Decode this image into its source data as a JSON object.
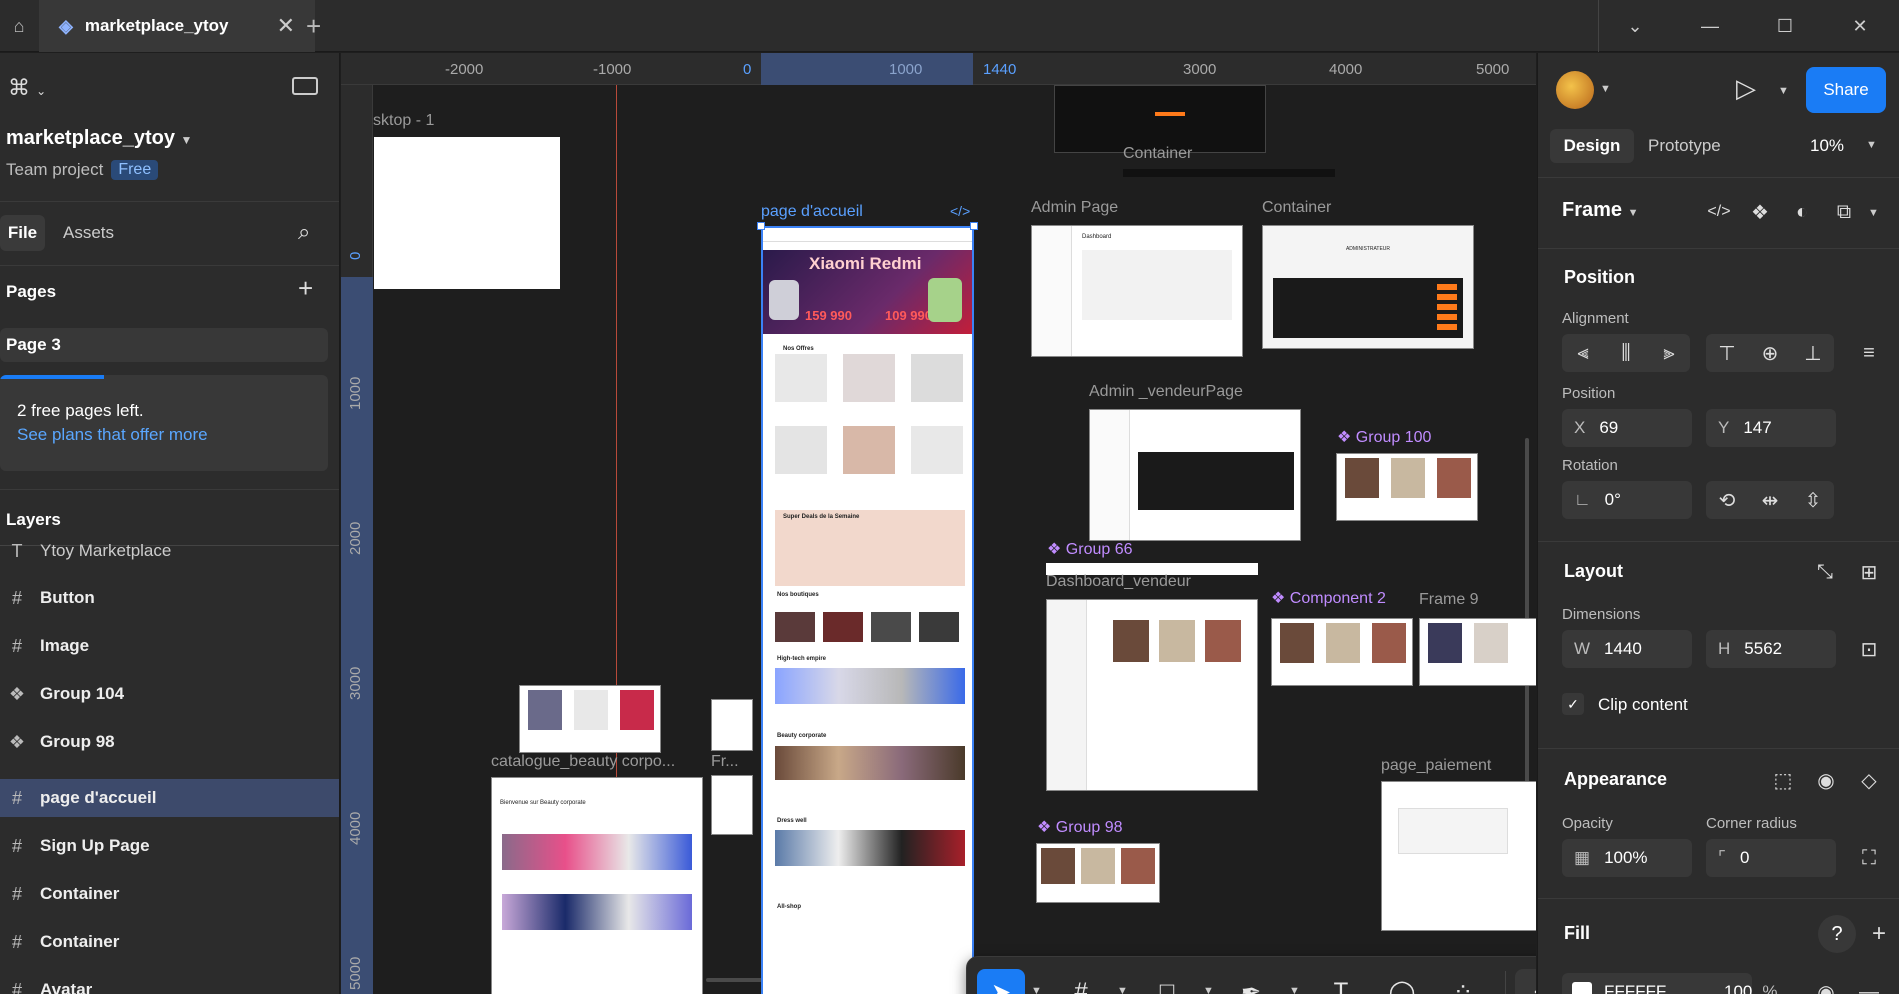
{
  "titlebar": {
    "tab_title": "marketplace_ytoy",
    "new_tab": "+",
    "controls": [
      "⌄",
      "—",
      "☐",
      "✕"
    ]
  },
  "left_panel": {
    "project_name": "marketplace_ytoy",
    "team_label": "Team project",
    "plan_badge": "Free",
    "tabs": {
      "file": "File",
      "assets": "Assets"
    },
    "pages_title": "Pages",
    "current_page": "Page 3",
    "free_pages_text": "2 free pages left.",
    "plans_link": "See plans that offer more",
    "layers_title": "Layers",
    "layers": [
      {
        "icon": "text",
        "name": "Ytoy Marketplace",
        "type": "text"
      },
      {
        "icon": "frame",
        "name": "Button",
        "type": "frame"
      },
      {
        "icon": "frame",
        "name": "Image",
        "type": "frame"
      },
      {
        "icon": "component",
        "name": "Group 104",
        "type": "component"
      },
      {
        "icon": "component",
        "name": "Group 98",
        "type": "component"
      },
      {
        "icon": "frame",
        "name": "page d'accueil",
        "type": "frame",
        "selected": true
      },
      {
        "icon": "frame",
        "name": "Sign Up Page",
        "type": "frame"
      },
      {
        "icon": "frame",
        "name": "Container",
        "type": "frame"
      },
      {
        "icon": "frame",
        "name": "Container",
        "type": "frame"
      },
      {
        "icon": "frame",
        "name": "Avatar",
        "type": "frame"
      }
    ]
  },
  "canvas": {
    "ruler_top": [
      "-2000",
      "-1000",
      "0",
      "1000",
      "1440",
      "3000",
      "4000",
      "5000"
    ],
    "ruler_left": [
      "0",
      "1000",
      "2000",
      "3000",
      "4000",
      "5000"
    ],
    "frames": {
      "desktop": "sktop - 1",
      "container_top": "Container",
      "page_accueil": "page d'accueil",
      "admin_page": "Admin Page",
      "container_right": "Container",
      "admin_vendeur": "Admin _vendeurPage",
      "group100": "Group 100",
      "group66": "Group 66",
      "dashboard_vendeur": "Dashboard_vendeur",
      "component2": "Component 2",
      "frame9": "Frame 9",
      "catalogue": "catalogue_beauty corpo...",
      "fr": "Fr...",
      "group98": "Group 98",
      "page_paiement": "page_paiement"
    },
    "thumb_text": {
      "xiaomi": "Xiaomi Redmi",
      "nos_offres": "Nos Offres",
      "super_deals": "Super Deals de la Semaine",
      "nos_boutiques": "Nos boutiques",
      "high_tech": "High-tech empire",
      "beauty": "Beauty corporate",
      "dress": "Dress well",
      "allshop": "All-shop",
      "price1": "159 990",
      "price2": "109 990",
      "dashboard": "Dashboard",
      "admin_header": "ADMINISTRATEUR",
      "welcome_beauty": "Bienvenue sur Beauty corporate"
    }
  },
  "toolbar": {
    "tools": [
      "move-tool",
      "frame-tool",
      "shape-tool",
      "pen-tool",
      "text-tool",
      "comment-tool",
      "assets-tool",
      "dev-mode-toggle"
    ]
  },
  "right_panel": {
    "share": "Share",
    "tabs": {
      "design": "Design",
      "prototype": "Prototype"
    },
    "zoom": "10%",
    "frame_type": "Frame",
    "position_title": "Position",
    "alignment_label": "Alignment",
    "position_label": "Position",
    "x_label": "X",
    "x_value": "69",
    "y_label": "Y",
    "y_value": "147",
    "rotation_label": "Rotation",
    "rotation_value": "0°",
    "layout_title": "Layout",
    "dimensions_label": "Dimensions",
    "w_label": "W",
    "w_value": "1440",
    "h_label": "H",
    "h_value": "5562",
    "clip_content": "Clip content",
    "appearance_title": "Appearance",
    "opacity_label": "Opacity",
    "opacity_value": "100%",
    "corner_label": "Corner radius",
    "corner_value": "0",
    "fill_title": "Fill",
    "fill_hex": "FFFFFF",
    "fill_opacity": "100",
    "fill_pct": "%",
    "help": "?"
  }
}
